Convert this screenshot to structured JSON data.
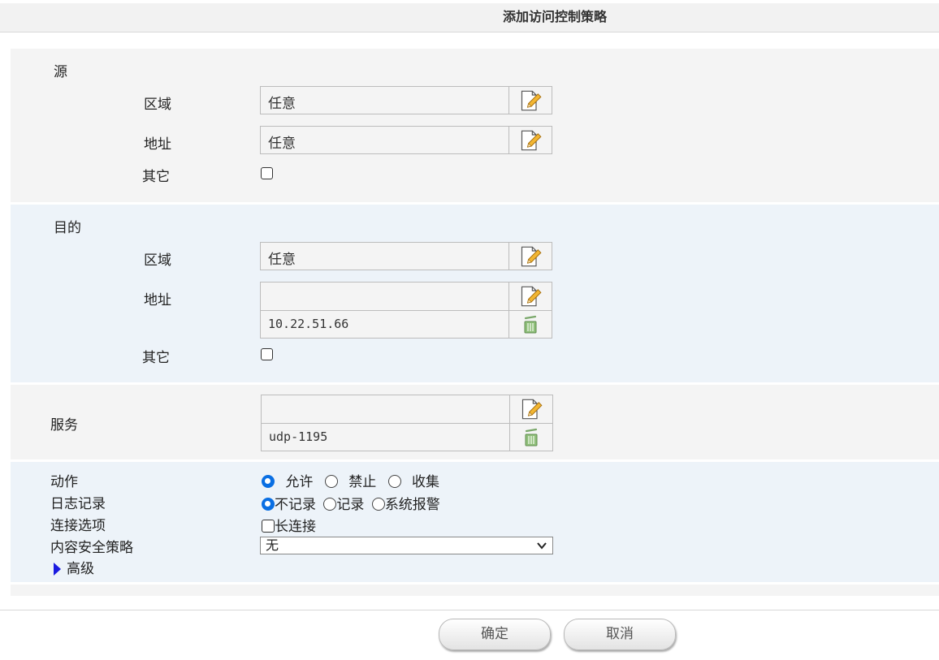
{
  "title": "添加访问控制策略",
  "source": {
    "heading": "源",
    "zone_label": "区域",
    "zone_value": "任意",
    "address_label": "地址",
    "address_value": "任意",
    "other_label": "其它"
  },
  "destination": {
    "heading": "目的",
    "zone_label": "区域",
    "zone_value": "任意",
    "address_label": "地址",
    "address_value": "",
    "address_entry": "10.22.51.66",
    "other_label": "其它"
  },
  "service": {
    "heading": "服务",
    "value": "",
    "entry": "udp-1195"
  },
  "action": {
    "label": "动作",
    "options": [
      "允许",
      "禁止",
      "收集"
    ],
    "selected": "允许"
  },
  "logging": {
    "label": "日志记录",
    "options": [
      "不记录",
      "记录",
      "系统报警"
    ],
    "selected": "不记录"
  },
  "connection": {
    "label": "连接选项",
    "option": "长连接",
    "checked": false
  },
  "content_policy": {
    "label": "内容安全策略",
    "selected": "无"
  },
  "advanced_label": "高级",
  "buttons": {
    "ok": "确定",
    "cancel": "取消"
  },
  "colors": {
    "radio_accent": "#0a6fe3",
    "arrow": "#1a1ae0",
    "trash": "#7aa86a"
  }
}
